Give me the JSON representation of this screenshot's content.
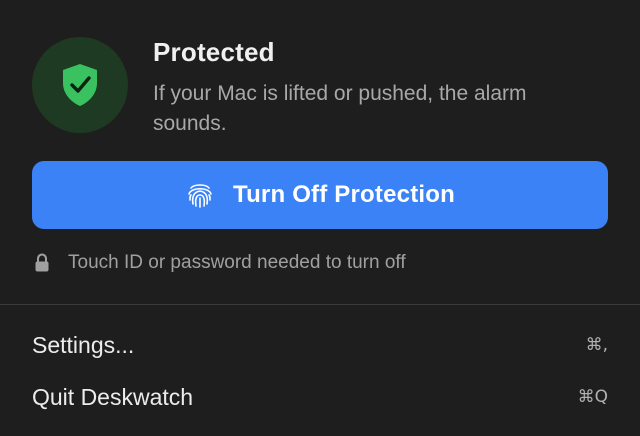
{
  "status": {
    "title": "Protected",
    "description": "If your Mac is lifted or pushed, the alarm sounds.",
    "icon": "shield-check-icon",
    "icon_color": "#39c25f",
    "badge_bg": "#1f3a22"
  },
  "primary_action": {
    "label": "Turn Off Protection",
    "icon": "fingerprint-icon",
    "bg_color": "#3b82f6"
  },
  "hint": {
    "icon": "lock-icon",
    "text": "Touch ID or password needed to turn off"
  },
  "menu": {
    "items": [
      {
        "label": "Settings...",
        "shortcut": "⌘,"
      },
      {
        "label": "Quit Deskwatch",
        "shortcut": "⌘Q"
      }
    ]
  }
}
